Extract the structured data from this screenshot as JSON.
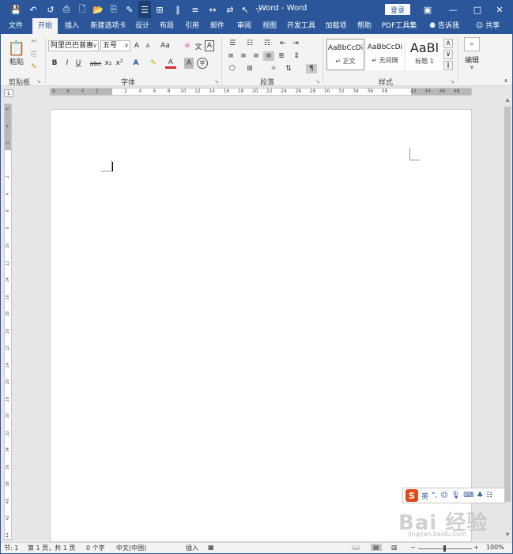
{
  "window": {
    "title_app": "Word",
    "title_sep": "-",
    "title_doc": "Word",
    "login_label": "登录",
    "controls": [
      "ribbon-display-icon",
      "minimize-icon",
      "maximize-icon",
      "close-icon"
    ]
  },
  "quick_access": [
    "save-icon",
    "undo-icon",
    "redo-icon",
    "print-preview-icon",
    "new-doc-icon",
    "open-icon",
    "paste-special-icon",
    "format-painter-icon",
    "read-mode-icon",
    "table-icon",
    "columns-icon",
    "line-spacing-icon",
    "find-replace-icon",
    "select-icon",
    "customize-icon"
  ],
  "tabs": [
    "文件",
    "开始",
    "插入",
    "新建选项卡",
    "设计",
    "布局",
    "引用",
    "邮件",
    "审阅",
    "视图",
    "开发工具",
    "加载项",
    "帮助",
    "PDF工具集"
  ],
  "active_tab": "开始",
  "tell_me": "告诉我",
  "share": "共享",
  "ribbon": {
    "clipboard": {
      "paste": "粘贴",
      "label": "剪贴板"
    },
    "font": {
      "font_name": "阿里巴巴普惠",
      "font_size": "五号",
      "grow": "A",
      "shrink": "A",
      "change_case": "Aa",
      "bold": "B",
      "italic": "I",
      "underline": "U",
      "strike": "abc",
      "sub": "x₂",
      "sup": "x²",
      "font_color": "A",
      "boxed": "A",
      "enclosed": "字",
      "label": "字体"
    },
    "paragraph": {
      "label": "段落"
    },
    "styles": {
      "items": [
        {
          "sample": "AaBbCcDi",
          "name": "↵ 正文"
        },
        {
          "sample": "AaBbCcDi",
          "name": "↵ 无间隔"
        },
        {
          "sample": "AaBl",
          "name": "标题 1"
        }
      ],
      "label": "样式"
    },
    "editing": {
      "label": "编辑"
    }
  },
  "ruler": {
    "h_ticks": [
      "8",
      "6",
      "4",
      "2",
      "",
      "2",
      "4",
      "6",
      "8",
      "10",
      "12",
      "14",
      "16",
      "18",
      "20",
      "22",
      "24",
      "26",
      "28",
      "30",
      "32",
      "34",
      "36",
      "38",
      "",
      "42",
      "44",
      "46",
      "48"
    ],
    "v_ticks": [
      "6",
      "4",
      "2",
      "",
      "2",
      "4",
      "6",
      "8",
      "10",
      "12",
      "14",
      "16",
      "18",
      "20",
      "22",
      "24",
      "26",
      "28",
      "30",
      "32",
      "34",
      "36",
      "38",
      "40",
      "42",
      "44"
    ]
  },
  "ime": {
    "lang": "英",
    "punct": "°,"
  },
  "watermark": {
    "text": "Bai 经验",
    "sub": "jingyan.baidu.com"
  },
  "status": {
    "section": "节: 1",
    "page": "第 1 页，共 1 页",
    "words": "0 个字",
    "language": "中文(中国)",
    "mode": "插入",
    "zoom": "100%"
  }
}
